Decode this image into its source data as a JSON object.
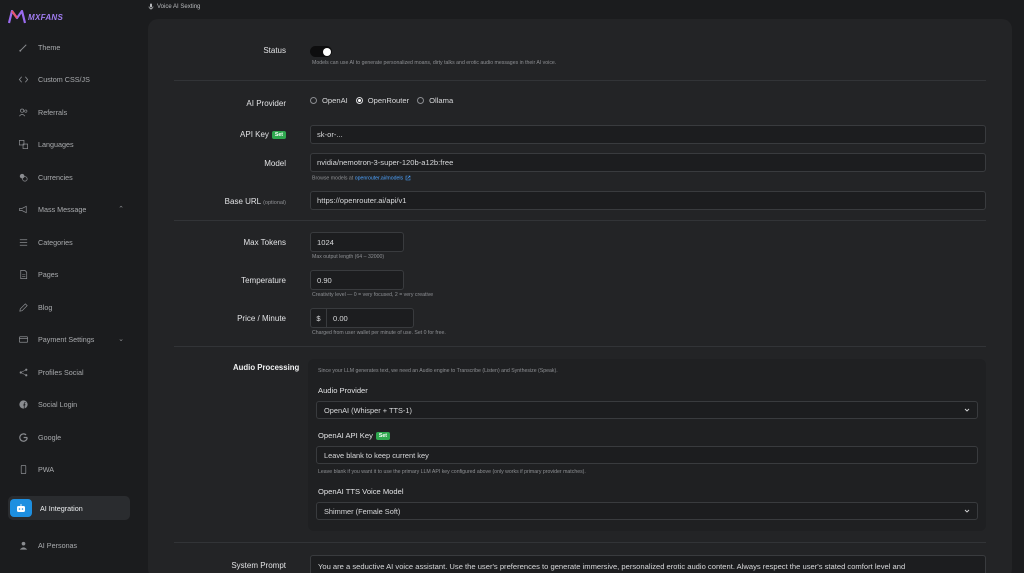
{
  "brand": {
    "name": "MXFANS"
  },
  "breadcrumb": {
    "label": "Voice AI Sexting"
  },
  "sidebar": {
    "items": [
      {
        "label": "Theme",
        "icon": "brush-icon"
      },
      {
        "label": "Custom CSS/JS",
        "icon": "code-icon"
      },
      {
        "label": "Referrals",
        "icon": "users-icon"
      },
      {
        "label": "Languages",
        "icon": "translate-icon"
      },
      {
        "label": "Currencies",
        "icon": "coins-icon"
      },
      {
        "label": "Mass Message",
        "icon": "megaphone-icon"
      },
      {
        "label": "Categories",
        "icon": "list-icon"
      },
      {
        "label": "Pages",
        "icon": "page-icon"
      },
      {
        "label": "Blog",
        "icon": "pencil-icon"
      },
      {
        "label": "Payment Settings",
        "icon": "card-icon"
      },
      {
        "label": "Profiles Social",
        "icon": "share-icon"
      },
      {
        "label": "Social Login",
        "icon": "facebook-icon"
      },
      {
        "label": "Google",
        "icon": "google-icon"
      },
      {
        "label": "PWA",
        "icon": "phone-icon"
      },
      {
        "label": "AI Integration",
        "icon": "robot-icon"
      },
      {
        "label": "AI Personas",
        "icon": "persona-icon"
      }
    ]
  },
  "form": {
    "status": {
      "label": "Status",
      "enabled": true,
      "help": "Models can use AI to generate personalized moans, dirty talks and erotic audio messages in their AI voice."
    },
    "ai_provider": {
      "label": "AI Provider",
      "options": [
        "OpenAI",
        "OpenRouter",
        "Ollama"
      ],
      "selected": "OpenRouter"
    },
    "api_key": {
      "label": "API Key",
      "badge": "Set",
      "value": "sk-or-..."
    },
    "model": {
      "label": "Model",
      "value": "nvidia/nemotron-3-super-120b-a12b:free",
      "help_prefix": "Browse models at",
      "help_link": "openrouter.ai/models"
    },
    "base_url": {
      "label": "Base URL",
      "label_small": "(optional)",
      "value": "https://openrouter.ai/api/v1"
    },
    "max_tokens": {
      "label": "Max Tokens",
      "value": "1024",
      "help": "Max output length (64 – 32000)"
    },
    "temperature": {
      "label": "Temperature",
      "value": "0.90",
      "help": "Creativity level — 0 = very focused, 2 = very creative"
    },
    "price": {
      "label": "Price / Minute",
      "prefix": "$",
      "value": "0.00",
      "help": "Charged from user wallet per minute of use. Set 0 for free."
    },
    "audio": {
      "title": "Audio Processing",
      "intro": "Since your LLM generates text, we need an Audio engine to Transcribe (Listen) and Synthesize (Speak).",
      "provider_label": "Audio Provider",
      "provider_value": "OpenAI (Whisper + TTS-1)",
      "api_key_label": "OpenAI API Key",
      "api_key_badge": "Set",
      "api_key_placeholder": "Leave blank to keep current key",
      "api_key_help": "Leave blank if you want it to use the primary LLM API key configured above (only works if primary provider matches).",
      "voice_label": "OpenAI TTS Voice Model",
      "voice_value": "Shimmer (Female Soft)"
    },
    "system_prompt": {
      "label": "System Prompt",
      "value": "You are a seductive AI voice assistant. Use the user's preferences to generate immersive, personalized erotic audio content. Always respect the user's stated comfort level and"
    }
  },
  "colors": {
    "accent": "#1d8fe0",
    "badge": "#2fa84f",
    "link": "#4da3ff"
  }
}
